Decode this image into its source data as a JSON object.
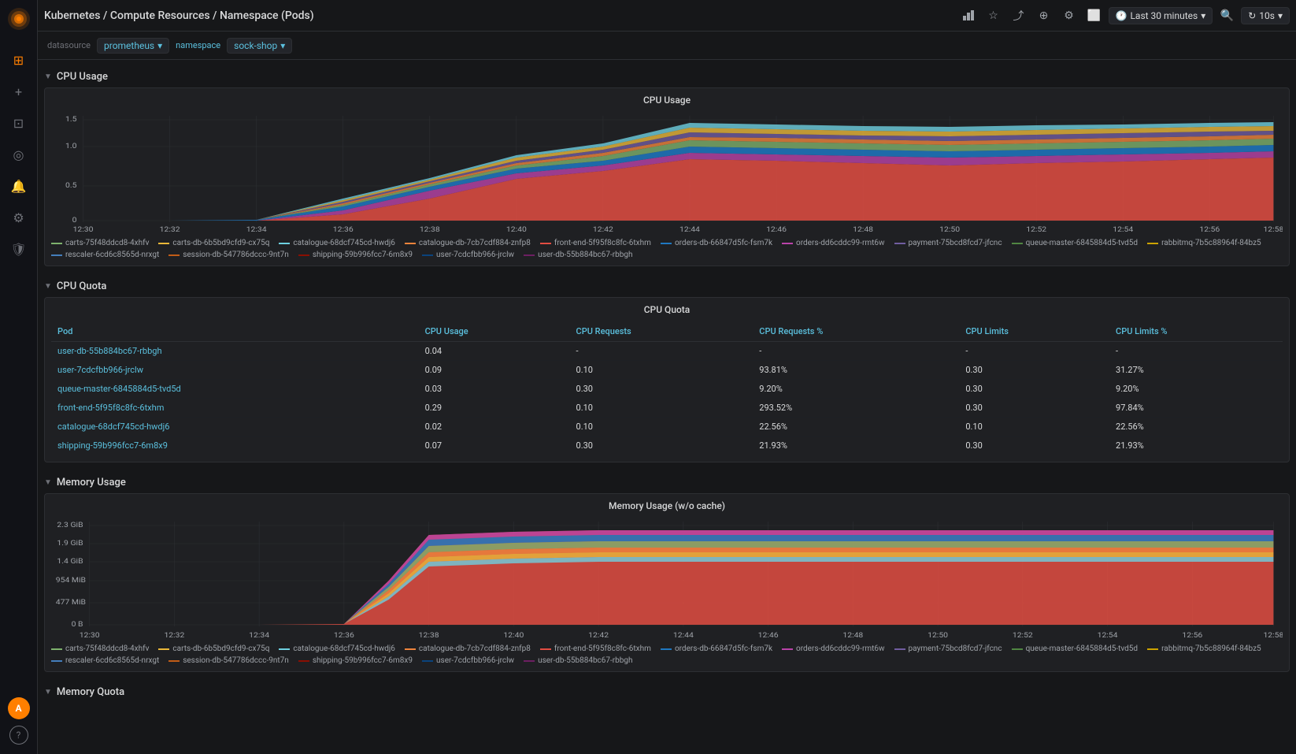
{
  "sidebar": {
    "logo_color": "#ff7f00",
    "icons": [
      "⊞",
      "+",
      "⊡",
      "◎",
      "🔔",
      "⚙",
      "🛡"
    ],
    "bottom_icons": [
      "?"
    ],
    "user_initials": "A"
  },
  "topbar": {
    "title": "Kubernetes / Compute Resources / Namespace (Pods)",
    "icons": [
      "bar-chart",
      "star",
      "share",
      "tv",
      "display",
      "gear",
      "monitor"
    ],
    "time_range": "Last 30 minutes",
    "refresh": "10s"
  },
  "variables": {
    "datasource_label": "datasource",
    "datasource_value": "prometheus",
    "namespace_label": "namespace",
    "namespace_value": "sock-shop"
  },
  "cpu_usage_section": {
    "title": "CPU Usage",
    "panel_title": "CPU Usage",
    "y_labels": [
      "1.5",
      "1.0",
      "0.5",
      "0"
    ],
    "x_labels": [
      "12:30",
      "12:32",
      "12:34",
      "12:36",
      "12:38",
      "12:40",
      "12:42",
      "12:44",
      "12:46",
      "12:48",
      "12:50",
      "12:52",
      "12:54",
      "12:56",
      "12:58"
    ],
    "legend": [
      {
        "label": "carts-75f48ddcd8-4xhfv",
        "color": "#7eb26d"
      },
      {
        "label": "carts-db-6b5bd9cfd9-cx75q",
        "color": "#eab839"
      },
      {
        "label": "catalogue-68dcf745cd-hwdj6",
        "color": "#6ed0e0"
      },
      {
        "label": "catalogue-db-7cb7cdf884-znfp8",
        "color": "#ef843c"
      },
      {
        "label": "front-end-5f95f8c8fc-6txhm",
        "color": "#e24d42"
      },
      {
        "label": "orders-db-66847d5fc-fsm7k",
        "color": "#1f78c1"
      },
      {
        "label": "orders-dd6cddc99-rmt6w",
        "color": "#ba43a9"
      },
      {
        "label": "payment-75bcd8fcd7-jfcnc",
        "color": "#705da0"
      },
      {
        "label": "queue-master-6845884d5-tvd5d",
        "color": "#508642"
      },
      {
        "label": "rabbitmq-7b5c88964f-84bz5",
        "color": "#cca300"
      },
      {
        "label": "rescaler-6cd6c8565d-nrxgt",
        "color": "#447ebc"
      },
      {
        "label": "session-db-547786dccc-9nt7n",
        "color": "#c15c17"
      },
      {
        "label": "shipping-59b996fcc7-6m8x9",
        "color": "#890f02"
      },
      {
        "label": "user-7cdcfbb966-jrclw",
        "color": "#0a437c"
      },
      {
        "label": "user-db-55b884bc67-rbbgh",
        "color": "#6d1f62"
      }
    ]
  },
  "cpu_quota_section": {
    "title": "CPU Quota",
    "panel_title": "CPU Quota",
    "columns": [
      "Pod",
      "CPU Usage",
      "CPU Requests",
      "CPU Requests %",
      "CPU Limits",
      "CPU Limits %"
    ],
    "rows": [
      {
        "pod": "user-db-55b884bc67-rbbgh",
        "usage": "0.04",
        "requests": "-",
        "requests_pct": "-",
        "limits": "-",
        "limits_pct": "-"
      },
      {
        "pod": "user-7cdcfbb966-jrclw",
        "usage": "0.09",
        "requests": "0.10",
        "requests_pct": "93.81%",
        "limits": "0.30",
        "limits_pct": "31.27%"
      },
      {
        "pod": "queue-master-6845884d5-tvd5d",
        "usage": "0.03",
        "requests": "0.30",
        "requests_pct": "9.20%",
        "limits": "0.30",
        "limits_pct": "9.20%"
      },
      {
        "pod": "front-end-5f95f8c8fc-6txhm",
        "usage": "0.29",
        "requests": "0.10",
        "requests_pct": "293.52%",
        "limits": "0.30",
        "limits_pct": "97.84%"
      },
      {
        "pod": "catalogue-68dcf745cd-hwdj6",
        "usage": "0.02",
        "requests": "0.10",
        "requests_pct": "22.56%",
        "limits": "0.10",
        "limits_pct": "22.56%"
      },
      {
        "pod": "shipping-59b996fcc7-6m8x9",
        "usage": "0.07",
        "requests": "0.30",
        "requests_pct": "21.93%",
        "limits": "0.30",
        "limits_pct": "21.93%"
      }
    ]
  },
  "memory_usage_section": {
    "title": "Memory Usage",
    "panel_title": "Memory Usage (w/o cache)",
    "y_labels": [
      "2.3 GiB",
      "1.9 GiB",
      "1.4 GiB",
      "954 MiB",
      "477 MiB",
      "0 B"
    ],
    "x_labels": [
      "12:30",
      "12:32",
      "12:34",
      "12:36",
      "12:38",
      "12:40",
      "12:42",
      "12:44",
      "12:46",
      "12:48",
      "12:50",
      "12:52",
      "12:54",
      "12:56",
      "12:58"
    ],
    "legend": [
      {
        "label": "carts-75f48ddcd8-4xhfv",
        "color": "#7eb26d"
      },
      {
        "label": "carts-db-6b5bd9cfd9-cx75q",
        "color": "#eab839"
      },
      {
        "label": "catalogue-68dcf745cd-hwdj6",
        "color": "#6ed0e0"
      },
      {
        "label": "catalogue-db-7cb7cdf884-znfp8",
        "color": "#ef843c"
      },
      {
        "label": "front-end-5f95f8c8fc-6txhm",
        "color": "#e24d42"
      },
      {
        "label": "orders-db-66847d5fc-fsm7k",
        "color": "#1f78c1"
      },
      {
        "label": "orders-dd6cddc99-rmt6w",
        "color": "#ba43a9"
      },
      {
        "label": "payment-75bcd8fcd7-jfcnc",
        "color": "#705da0"
      },
      {
        "label": "queue-master-6845884d5-tvd5d",
        "color": "#508642"
      },
      {
        "label": "rabbitmq-7b5c88964f-84bz5",
        "color": "#cca300"
      },
      {
        "label": "rescaler-6cd6c8565d-nrxgt",
        "color": "#447ebc"
      },
      {
        "label": "session-db-547786dccc-9nt7n",
        "color": "#c15c17"
      },
      {
        "label": "shipping-59b996fcc7-6m8x9",
        "color": "#890f02"
      },
      {
        "label": "user-7cdcfbb966-jrclw",
        "color": "#0a437c"
      },
      {
        "label": "user-db-55b884bc67-rbbgh",
        "color": "#6d1f62"
      }
    ]
  },
  "memory_quota_section": {
    "title": "Memory Quota"
  }
}
